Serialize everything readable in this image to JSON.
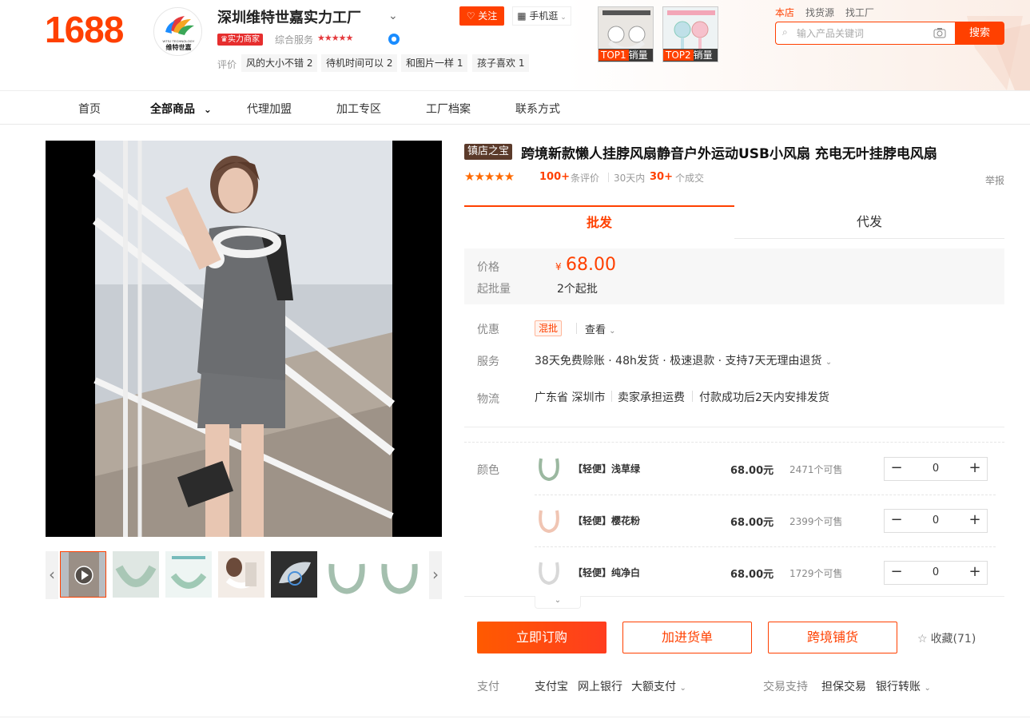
{
  "brand": {
    "logo": "1688"
  },
  "shop": {
    "name": "深圳维特世嘉实力工厂",
    "logo_text": "维特世嘉",
    "logo_sub": "WTSJ TECHNOLOGY",
    "badge": "实力商家",
    "service_label": "综合服务",
    "service_stars": "★★★★★",
    "review_label": "评价",
    "review_tags": [
      "风的大小不错 2",
      "待机时间可以 2",
      "和图片一样 1",
      "孩子喜欢 1"
    ],
    "follow_label": "关注",
    "mobile_label": "手机逛"
  },
  "top_products": [
    {
      "rank": "TOP1",
      "label": "销量"
    },
    {
      "rank": "TOP2",
      "label": "销量"
    }
  ],
  "search": {
    "tabs": [
      "本店",
      "找货源",
      "找工厂"
    ],
    "placeholder": "输入产品关键词",
    "button": "搜索"
  },
  "nav": [
    "首页",
    "全部商品",
    "代理加盟",
    "加工专区",
    "工厂档案",
    "联系方式"
  ],
  "product": {
    "badge": "镇店之宝",
    "title": "跨境新款懒人挂脖风扇静音户外运动USB小风扇 充电无叶挂脖电风扇",
    "rating_stars": "★★★★★",
    "review_count": "100+",
    "review_unit": "条评价",
    "sales_period": "30天内",
    "sales_count": "30+",
    "sales_unit": "个成交",
    "report": "举报",
    "tabs": [
      "批发",
      "代发"
    ],
    "price_label": "价格",
    "currency": "¥",
    "price": "68.00",
    "moq_label": "起批量",
    "moq": "2个起批",
    "promo_label": "优惠",
    "promo_tag": "混批",
    "promo_view": "查看",
    "service_label": "服务",
    "service_text": "38天免费赊账 · 48h发货 · 极速退款 · 支持7天无理由退货",
    "logistics_label": "物流",
    "logistics": [
      "广东省 深圳市",
      "卖家承担运费",
      "付款成功后2天内安排发货"
    ],
    "color_label": "颜色",
    "skus": [
      {
        "name": "【轻便】浅草绿",
        "price": "68.00元",
        "stock": "2471个可售",
        "qty": "0",
        "color": "#9bb8a0"
      },
      {
        "name": "【轻便】樱花粉",
        "price": "68.00元",
        "stock": "2399个可售",
        "qty": "0",
        "color": "#f0c5b3"
      },
      {
        "name": "【轻便】纯净白",
        "price": "68.00元",
        "stock": "1729个可售",
        "qty": "0",
        "color": "#d8d8d8"
      }
    ],
    "buy_now": "立即订购",
    "add_cart": "加进货单",
    "cross_border": "跨境铺货",
    "favorite": "收藏(71)",
    "pay_label": "支付",
    "pay_methods": [
      "支付宝",
      "网上银行",
      "大额支付"
    ],
    "trade_label": "交易支持",
    "trade_methods": [
      "担保交易",
      "银行转账"
    ]
  },
  "colors": {
    "accent": "#ff4000",
    "brand": "#ff4000"
  }
}
